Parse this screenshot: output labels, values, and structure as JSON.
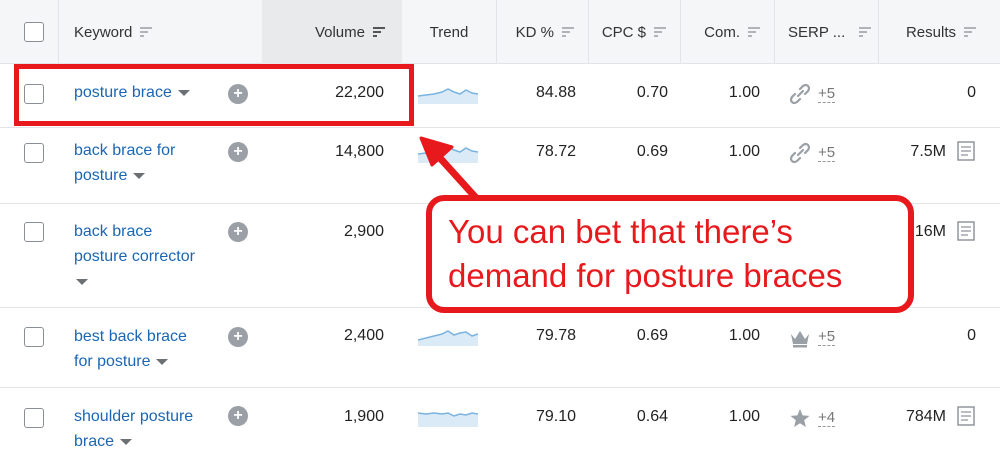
{
  "columns": {
    "keyword": "Keyword",
    "volume": "Volume",
    "trend": "Trend",
    "kd": "KD %",
    "cpc": "CPC $",
    "com": "Com.",
    "serp": "SERP ...",
    "results": "Results"
  },
  "rows": [
    {
      "kw1": "posture brace",
      "kw2": "",
      "kw3": "",
      "volume": "22,200",
      "kd": "84.88",
      "cpc": "0.70",
      "com": "1.00",
      "serp_icon": "link-icon",
      "serp_more": "+5",
      "results": "0"
    },
    {
      "kw1": "back brace for",
      "kw2": "posture",
      "kw3": "",
      "volume": "14,800",
      "kd": "78.72",
      "cpc": "0.69",
      "com": "1.00",
      "serp_icon": "link-icon",
      "serp_more": "+5",
      "results": "7.5M"
    },
    {
      "kw1": "back brace",
      "kw2": "posture corrector",
      "kw3": "",
      "volume": "2,900",
      "kd": "",
      "cpc": "",
      "com": "",
      "serp_icon": "",
      "serp_more": "",
      "results": "16M"
    },
    {
      "kw1": "best back brace",
      "kw2": "for posture",
      "kw3": "",
      "volume": "2,400",
      "kd": "79.78",
      "cpc": "0.69",
      "com": "1.00",
      "serp_icon": "crown-icon",
      "serp_more": "+5",
      "results": "0"
    },
    {
      "kw1": "shoulder posture",
      "kw2": "brace",
      "kw3": "",
      "volume": "1,900",
      "kd": "79.10",
      "cpc": "0.64",
      "com": "1.00",
      "serp_icon": "star-icon",
      "serp_more": "+4",
      "results": "784M"
    }
  ],
  "callout": {
    "line1": "You can bet that there’s",
    "line2": "demand for posture braces"
  },
  "colors": {
    "highlight_red": "#e8191d",
    "link_blue": "#1a66b4",
    "sparkline": "#a8cdea"
  }
}
